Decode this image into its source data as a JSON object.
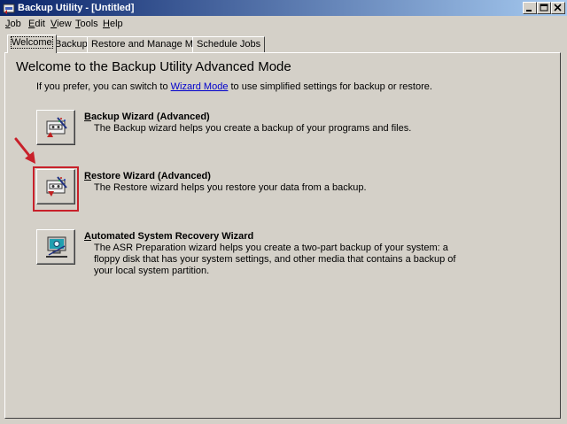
{
  "window": {
    "title": "Backup Utility - [Untitled]"
  },
  "menu": [
    {
      "label": "Job",
      "key": "J",
      "rest": "ob"
    },
    {
      "label": "Edit",
      "key": "E",
      "rest": "dit"
    },
    {
      "label": "View",
      "key": "V",
      "rest": "iew"
    },
    {
      "label": "Tools",
      "key": "T",
      "rest": "ools"
    },
    {
      "label": "Help",
      "key": "H",
      "rest": "elp"
    }
  ],
  "tabs": [
    "Welcome",
    "Backup",
    "Restore and Manage Media",
    "Schedule Jobs"
  ],
  "main": {
    "heading": "Welcome to the Backup Utility Advanced Mode",
    "intro_before": "If you prefer, you can switch to ",
    "intro_link": "Wizard Mode",
    "intro_after": " to use simplified settings for backup or restore."
  },
  "wizards": {
    "backup": {
      "title_key": "B",
      "title_rest": "ackup Wizard (Advanced)",
      "description": "The Backup wizard helps you create a backup of your programs and files."
    },
    "restore": {
      "title_key": "R",
      "title_rest": "estore Wizard (Advanced)",
      "description": "The Restore wizard helps you restore your data from a backup."
    },
    "asr": {
      "title_key": "A",
      "title_rest": "utomated System Recovery Wizard",
      "description": "The ASR Preparation wizard helps you create a two-part backup of your system: a floppy disk that has your system settings, and other media that contains a backup of your local system partition."
    }
  },
  "colors": {
    "title_gradient_start": "#0a246a",
    "title_gradient_end": "#a6caf0",
    "face": "#d4d0c8",
    "highlight_annotation": "#c8202a",
    "link": "#0000cc"
  },
  "icons": {
    "app": "backup-app-icon",
    "minimize": "minimize-icon",
    "maximize": "maximize-icon",
    "close": "close-icon",
    "backup": "backup-wizard-icon",
    "restore": "restore-wizard-icon",
    "asr": "asr-wizard-icon",
    "annotation": "red-arrow-icon"
  }
}
